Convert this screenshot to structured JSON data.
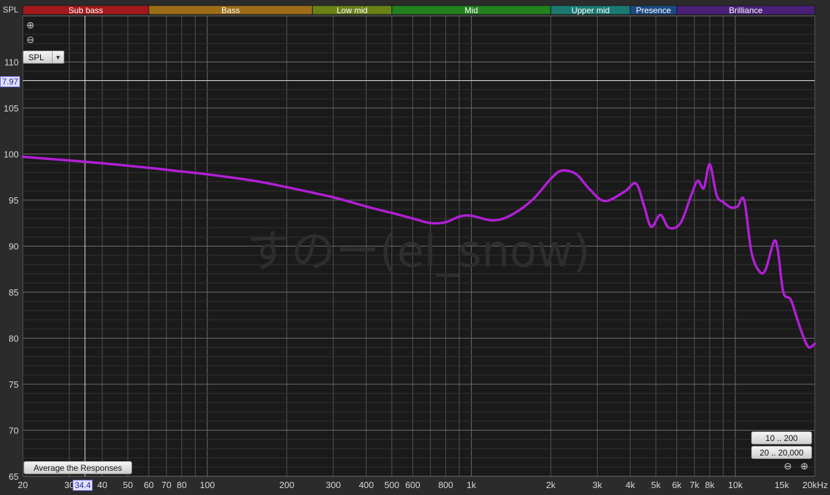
{
  "colors": {
    "background": "#1a1a1a",
    "grid": "#555555",
    "curve": "#b21fd6",
    "cursor": "#e6e6e6"
  },
  "y_axis_title": "SPL",
  "spl_select": {
    "value": "SPL"
  },
  "zoom_in_icon": "zoom-in-icon",
  "zoom_out_icon": "zoom-out-icon",
  "cursor_readout": {
    "y": "7.97",
    "x": "34.4"
  },
  "buttons": {
    "average": "Average the Responses",
    "range_10_200": "10 .. 200",
    "range_20_20000": "20 .. 20,000"
  },
  "watermark": "すのー(el_snow)",
  "bands": [
    {
      "label": "Sub bass",
      "from": 20,
      "to": 60,
      "color": "#a3191b"
    },
    {
      "label": "Bass",
      "from": 60,
      "to": 250,
      "color": "#9c6d16"
    },
    {
      "label": "Low mid",
      "from": 250,
      "to": 500,
      "color": "#6a8216"
    },
    {
      "label": "Mid",
      "from": 500,
      "to": 2000,
      "color": "#21811f"
    },
    {
      "label": "Upper mid",
      "from": 2000,
      "to": 4000,
      "color": "#1a7a72"
    },
    {
      "label": "Presence",
      "from": 4000,
      "to": 6000,
      "color": "#1c4a86"
    },
    {
      "label": "Brilliance",
      "from": 6000,
      "to": 20000,
      "color": "#4a1f78"
    }
  ],
  "chart_data": {
    "type": "line",
    "x_scale": "log",
    "xlim": [
      20,
      20000
    ],
    "ylim": [
      65,
      115
    ],
    "grid": true,
    "y_ticks": [
      65,
      70,
      75,
      80,
      85,
      90,
      95,
      100,
      105,
      110
    ],
    "x_ticks": [
      {
        "v": 20,
        "label": "20"
      },
      {
        "v": 30,
        "label": "30"
      },
      {
        "v": 40,
        "label": "40"
      },
      {
        "v": 50,
        "label": "50"
      },
      {
        "v": 60,
        "label": "60"
      },
      {
        "v": 70,
        "label": "70"
      },
      {
        "v": 80,
        "label": "80"
      },
      {
        "v": 100,
        "label": "100"
      },
      {
        "v": 200,
        "label": "200"
      },
      {
        "v": 300,
        "label": "300"
      },
      {
        "v": 400,
        "label": "400"
      },
      {
        "v": 500,
        "label": "500"
      },
      {
        "v": 600,
        "label": "600"
      },
      {
        "v": 800,
        "label": "800"
      },
      {
        "v": 1000,
        "label": "1k"
      },
      {
        "v": 2000,
        "label": "2k"
      },
      {
        "v": 3000,
        "label": "3k"
      },
      {
        "v": 4000,
        "label": "4k"
      },
      {
        "v": 5000,
        "label": "5k"
      },
      {
        "v": 6000,
        "label": "6k"
      },
      {
        "v": 7000,
        "label": "7k"
      },
      {
        "v": 8000,
        "label": "8k"
      },
      {
        "v": 10000,
        "label": "10k"
      },
      {
        "v": 15000,
        "label": "15k"
      },
      {
        "v": 20000,
        "label": "20kHz"
      }
    ],
    "cursor": {
      "x": 34.4,
      "y": 107.97
    },
    "series": [
      {
        "x": [
          20,
          30,
          40,
          60,
          80,
          100,
          150,
          200,
          300,
          400,
          500,
          600,
          700,
          800,
          900,
          1000,
          1200,
          1400,
          1700,
          2000,
          2200,
          2500,
          2800,
          3200,
          3800,
          4200,
          4500,
          4800,
          5200,
          5600,
          6200,
          6800,
          7200,
          7600,
          8000,
          8500,
          9000,
          9600,
          10200,
          10800,
          11500,
          12300,
          13000,
          14000,
          14500,
          15200,
          16200,
          17200,
          18200,
          19000,
          20000
        ],
        "y": [
          99.7,
          99.3,
          99.0,
          98.5,
          98.1,
          97.8,
          97.1,
          96.4,
          95.3,
          94.3,
          93.6,
          93.0,
          92.5,
          92.6,
          93.2,
          93.3,
          92.8,
          93.3,
          95.0,
          97.3,
          98.2,
          97.8,
          96.2,
          94.9,
          95.9,
          96.8,
          94.5,
          92.1,
          93.4,
          92.0,
          92.5,
          95.5,
          97.1,
          96.3,
          98.9,
          95.5,
          94.8,
          94.2,
          94.3,
          95.0,
          89.4,
          87.3,
          87.4,
          90.5,
          89.5,
          85.0,
          84.2,
          82.0,
          80.0,
          79.0,
          79.4
        ]
      }
    ]
  }
}
